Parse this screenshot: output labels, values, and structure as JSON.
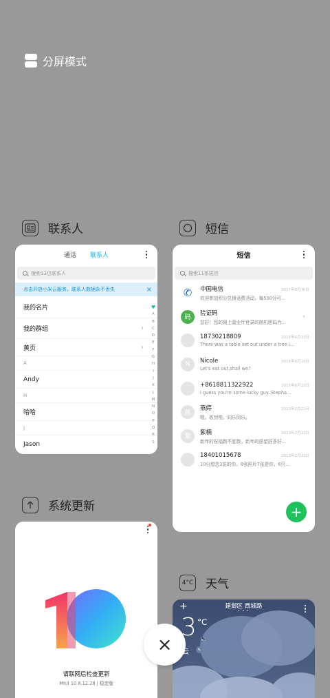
{
  "split_mode": {
    "label": "分屏模式"
  },
  "apps": {
    "contacts": {
      "name": "联系人",
      "tabs": [
        "通话",
        "联系人"
      ],
      "search_placeholder": "搜索13位联系人",
      "banner": "点击开启小米云服务，联系人数据永不丢失",
      "banner_close": "×",
      "rows": [
        "我的名片",
        "我的群组",
        "黄页",
        "A",
        "Andy",
        "H",
        "哈哈",
        "J",
        "Jason"
      ],
      "alphabet": [
        "♥",
        "A",
        "B",
        "C",
        "D",
        "E",
        "F",
        "G",
        "H",
        "I",
        "J",
        "K",
        "L",
        "M",
        "N",
        "O",
        "P",
        "Q",
        "R",
        "S"
      ]
    },
    "sms": {
      "name": "短信",
      "title": "短信",
      "search_placeholder": "搜索11条短信",
      "messages": [
        {
          "avatar": "✆",
          "name": "中国电信",
          "date": "2017年8月30日",
          "preview": "欢迎参加积分兑换话费活动，每500分可..."
        },
        {
          "avatar": "码",
          "name": "验证码",
          "date": "",
          "preview": "您好！您的网上营业厅登录的随机密码为..."
        },
        {
          "avatar": "",
          "name": "18730218809",
          "date": "2015年6月13日",
          "preview": "There was a table set out under a tree i..."
        },
        {
          "avatar": "N",
          "name": "Nicole",
          "date": "2015年6月13日",
          "preview": "Let's eat out,shall we?"
        },
        {
          "avatar": "",
          "name": "+8618811322922",
          "date": "2015年6月13日",
          "preview": "I guess you're some lucky guy..Stepha..."
        },
        {
          "avatar": "燕",
          "name": "燕婷",
          "date": "2013年2月22日",
          "preview": "嗯。收到啦。同乐同乐。"
        },
        {
          "avatar": "紫",
          "name": "紫楠",
          "date": "2013年2月22日",
          "preview": "新年的祝福数不胜数，新年的愿望好多好..."
        },
        {
          "avatar": "",
          "name": "18401015678",
          "date": "2013年2月22日",
          "preview": "10分想念3前的你，8张照片7张是你，6只..."
        }
      ],
      "fab": "+"
    },
    "update": {
      "name": "系统更新",
      "status": "请联网后检查更新",
      "version": "MIUI 10 8.12.28 | 稳定版"
    },
    "weather": {
      "name": "天气",
      "icon_text": "4°C",
      "location": "建邺区 西城路",
      "page_dots": "• • •",
      "temperature": "3",
      "unit": "°C",
      "description": "多云"
    }
  },
  "close_button": "×"
}
